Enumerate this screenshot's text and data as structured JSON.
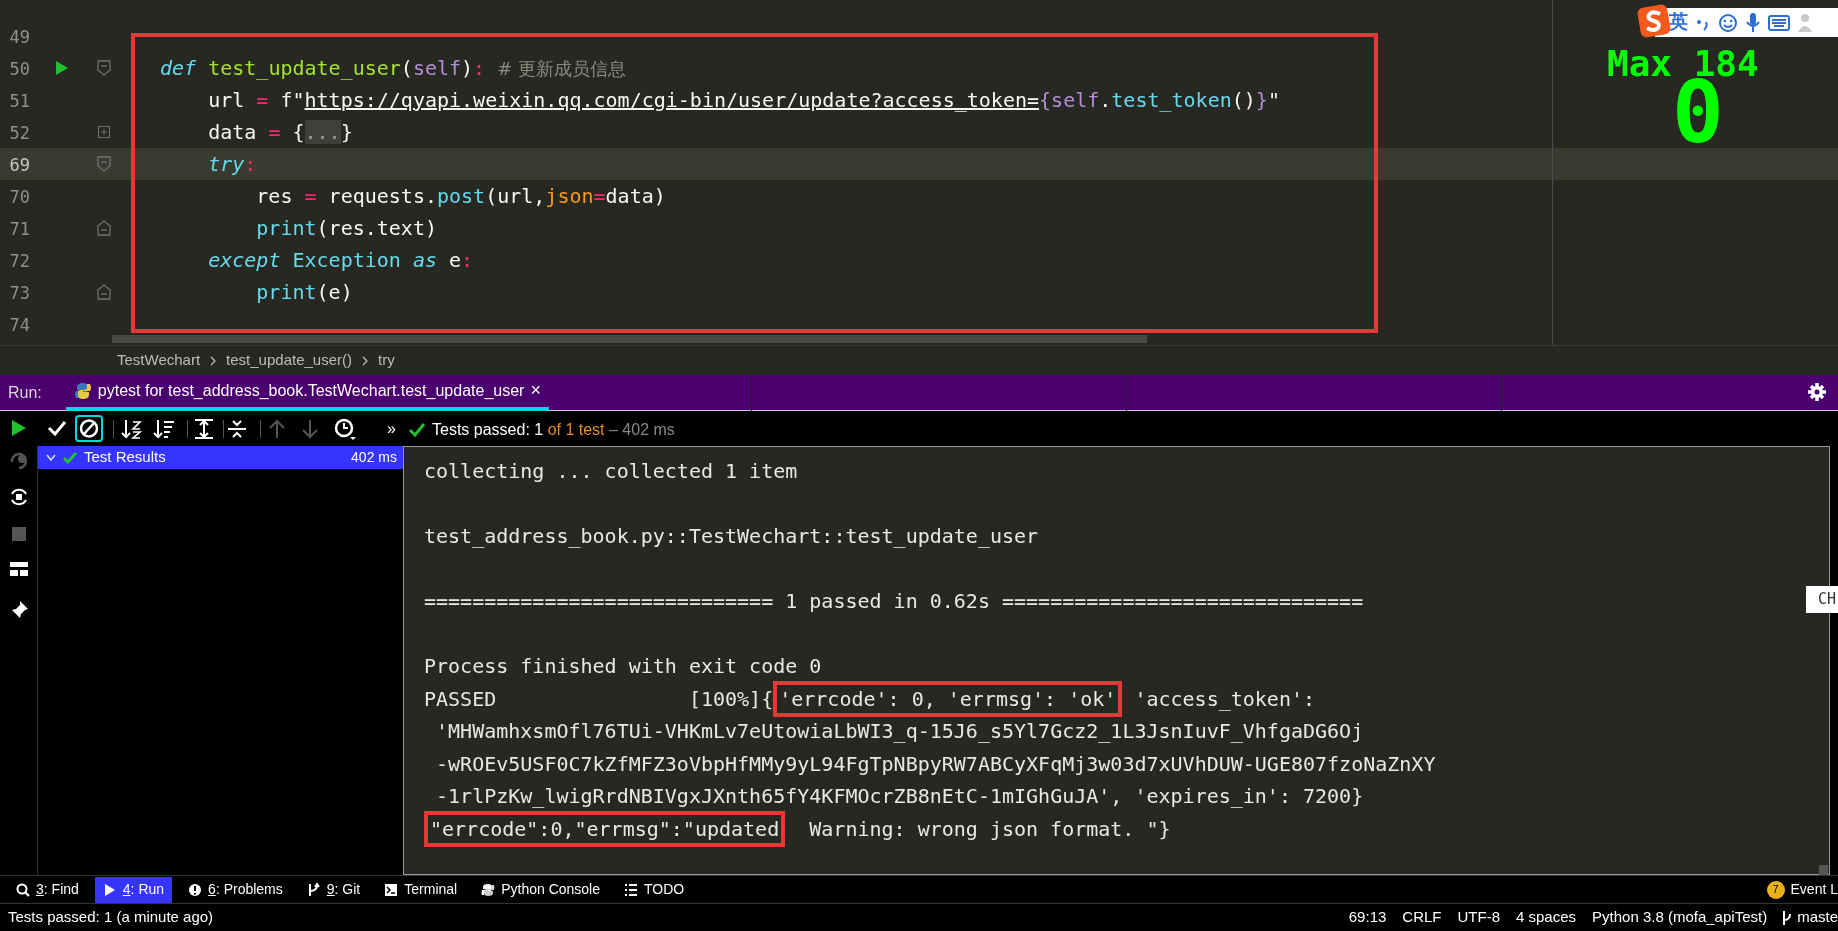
{
  "editor": {
    "lines": [
      {
        "number": "49",
        "current": false
      },
      {
        "number": "50",
        "current": false,
        "kind": "run-open",
        "tokens": [
          {
            "kind": "kw",
            "text": "def "
          },
          {
            "kind": "fn",
            "text": "test_update_user"
          },
          {
            "kind": "plain",
            "text": "("
          },
          {
            "kind": "self",
            "text": "self"
          },
          {
            "kind": "plain",
            "text": ")"
          },
          {
            "kind": "op",
            "text": ":"
          },
          {
            "kind": "comment",
            "text": " # 更新成员信息"
          }
        ]
      },
      {
        "number": "51",
        "current": false,
        "tokens": [
          {
            "kind": "plain",
            "text": "    url "
          },
          {
            "kind": "op",
            "text": "= "
          },
          {
            "kind": "plain",
            "text": "f\""
          },
          {
            "kind": "url",
            "text": "https://qyapi.weixin.qq.com/cgi-bin/user/update?access_token="
          },
          {
            "kind": "self",
            "text": "{self"
          },
          {
            "kind": "plain",
            "text": "."
          },
          {
            "kind": "builtin",
            "text": "test_token"
          },
          {
            "kind": "plain",
            "text": "()"
          },
          {
            "kind": "self",
            "text": "}"
          },
          {
            "kind": "plain",
            "text": "\""
          }
        ]
      },
      {
        "number": "52",
        "current": false,
        "kind": "expand",
        "tokens": [
          {
            "kind": "plain",
            "text": "    data "
          },
          {
            "kind": "op",
            "text": "= "
          },
          {
            "kind": "plain",
            "text": "{"
          },
          {
            "kind": "fold",
            "text": "..."
          },
          {
            "kind": "plain",
            "text": "}"
          }
        ]
      },
      {
        "number": "69",
        "current": true,
        "kind": "open",
        "tokens": [
          {
            "kind": "kw",
            "text": "    try"
          },
          {
            "kind": "op",
            "text": ":"
          }
        ]
      },
      {
        "number": "70",
        "current": false,
        "tokens": [
          {
            "kind": "plain",
            "text": "        res "
          },
          {
            "kind": "op",
            "text": "= "
          },
          {
            "kind": "plain",
            "text": "requests."
          },
          {
            "kind": "builtin",
            "text": "post"
          },
          {
            "kind": "plain",
            "text": "(url,"
          },
          {
            "kind": "kwarg",
            "text": "json"
          },
          {
            "kind": "op",
            "text": "="
          },
          {
            "kind": "plain",
            "text": "data)"
          }
        ]
      },
      {
        "number": "71",
        "current": false,
        "kind": "close",
        "tokens": [
          {
            "kind": "builtin",
            "text": "        print"
          },
          {
            "kind": "plain",
            "text": "(res.text)"
          }
        ]
      },
      {
        "number": "72",
        "current": false,
        "tokens": [
          {
            "kind": "kw",
            "text": "    except "
          },
          {
            "kind": "builtin",
            "text": "Exception "
          },
          {
            "kind": "kw",
            "text": "as "
          },
          {
            "kind": "plain",
            "text": "e"
          },
          {
            "kind": "op",
            "text": ":"
          }
        ]
      },
      {
        "number": "73",
        "current": false,
        "kind": "close",
        "tokens": [
          {
            "kind": "builtin",
            "text": "        print"
          },
          {
            "kind": "plain",
            "text": "(e)"
          }
        ]
      },
      {
        "number": "74",
        "current": false
      }
    ],
    "overlay": {
      "ime_mode": "英",
      "game_label": "Max 184",
      "game_score": "0"
    },
    "breadcrumb": [
      "TestWechart",
      "test_update_user()",
      "try"
    ]
  },
  "run": {
    "label": "Run:",
    "tab": "pytest for test_address_book.TestWechart.test_update_user",
    "close": "×",
    "more": "»",
    "summary": "Tests passed: 1",
    "summary_count": "of 1 test",
    "summary_time": "– 402 ms",
    "tree": [
      {
        "label": "Test Results",
        "time": "402 ms",
        "selected": true
      }
    ],
    "console": [
      {
        "lines": [
          [
            {
              "text": "collecting ... collected 1 item",
              "boxed": false
            }
          ]
        ]
      },
      {
        "lines": [
          [
            {
              "text": "test_address_book.py::TestWechart::test_update_user",
              "boxed": false
            }
          ]
        ]
      },
      {
        "lines": [
          [
            {
              "text": "============================= 1 passed in 0.62s ==============================",
              "boxed": false
            }
          ]
        ]
      },
      {
        "lines": [
          [
            {
              "text": "Process finished with exit code 0",
              "boxed": false
            }
          ],
          [
            {
              "text": "PASSED                [100%]{",
              "boxed": false
            },
            {
              "text": "'errcode': 0, 'errmsg': 'ok'",
              "boxed": true
            },
            {
              "text": " 'access_token':",
              "boxed": false
            }
          ],
          [
            {
              "text": " 'MHWamhxsmOfl76TUi-VHKmLv7eUtowiaLbWI3_q-15J6_s5Yl7Gcz2_1L3JsnIuvF_VhfgaDG6Oj",
              "boxed": false
            }
          ],
          [
            {
              "text": " -wROEv5USF0C7kZfMFZ3oVbpHfMMy9yL94FgTpNBpyRW7ABCyXFqMj3w03d7xUVhDUW-UGE807fzoNaZnXY",
              "boxed": false
            }
          ],
          [
            {
              "text": " -1rlPzKw_lwigRrdNBIVgxJXnth65fY4KFMOcrZB8nEtC-1mIGhGuJA', 'expires_in': 7200}",
              "boxed": false
            }
          ],
          [
            {
              "text": "\"errcode\":0,\"errmsg\":\"updated",
              "boxed": true
            },
            {
              "text": "  Warning: wrong json format. \"}",
              "boxed": false
            }
          ]
        ]
      }
    ],
    "side_tag": "CH"
  },
  "tool_windows": [
    {
      "key": "3",
      "label": ": Find",
      "kind": "search",
      "selected": false
    },
    {
      "key": "4",
      "label": ": Run",
      "kind": "run",
      "selected": true
    },
    {
      "key": "6",
      "label": ": Problems",
      "kind": "problems",
      "selected": false
    },
    {
      "key": "9",
      "label": ": Git",
      "kind": "git",
      "selected": false
    },
    {
      "label": "Terminal",
      "kind": "terminal",
      "selected": false
    },
    {
      "label": "Python Console",
      "kind": "python",
      "selected": false
    },
    {
      "label": "TODO",
      "kind": "todo",
      "selected": false
    }
  ],
  "event_log": {
    "count": "7",
    "label": "Event L"
  },
  "status_bar": {
    "message": "Tests passed: 1 (a minute ago)",
    "items": [
      "69:13",
      "CRLF",
      "UTF-8",
      "4 spaces",
      "Python 3.8 (mofa_apiTest)"
    ],
    "branch": "maste"
  }
}
